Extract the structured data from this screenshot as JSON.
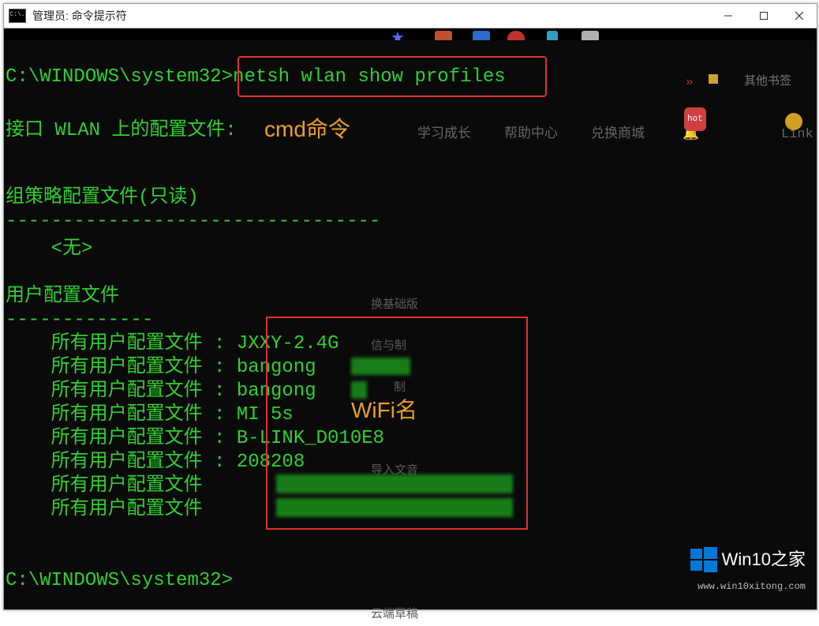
{
  "titlebar": {
    "icon_text": "C:\\.",
    "text": "管理员: 命令提示符"
  },
  "window_controls": {
    "minimize": "minimize",
    "maximize": "maximize",
    "close": "close"
  },
  "console": {
    "prompt1_path": "C:\\WINDOWS\\system32>",
    "prompt1_cmd": "netsh wlan show profiles",
    "section_interface": "接口 WLAN 上的配置文件:",
    "section_gpo_header": "组策略配置文件(只读)",
    "gpo_divider": "---------------------------------",
    "gpo_none": "    <无>",
    "section_user_header": "用户配置文件",
    "user_divider": "-------------",
    "profiles": [
      "    所有用户配置文件 : JXXY-2.4G",
      "    所有用户配置文件 : bangong",
      "    所有用户配置文件 : bangong",
      "    所有用户配置文件 : MI 5s",
      "    所有用户配置文件 : B-LINK_D010E8",
      "    所有用户配置文件 : 208208",
      "    所有用户配置文件",
      "    所有用户配置文件"
    ],
    "prompt2": "C:\\WINDOWS\\system32>"
  },
  "annotations": {
    "cmd_label": "cmd命令",
    "wifi_label": "WiFi名"
  },
  "ghost_nav": {
    "item1": "学习成长",
    "item2": "帮助中心",
    "item3": "兑换商城",
    "item4": "Link",
    "hot": "hot",
    "other_bookmarks": "其他书签",
    "arrow": "»"
  },
  "ghost_panel": {
    "p1": "换基础版",
    "p2": "信与制",
    "p3": "制",
    "p4": "导入文音",
    "p5": "云端草稿"
  },
  "watermark": {
    "title": "Win10之家",
    "sub": "www.win10xitong.com"
  }
}
